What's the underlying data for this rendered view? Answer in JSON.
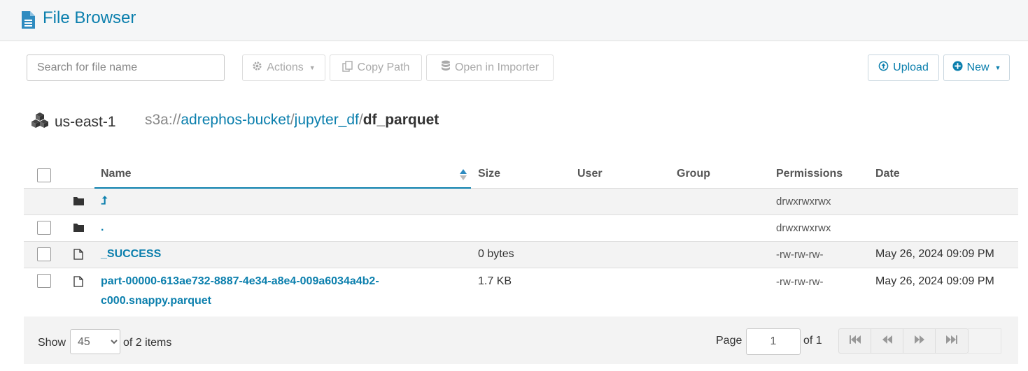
{
  "header": {
    "title": "File Browser",
    "icon": "document-icon",
    "accent": "#0b7fad"
  },
  "toolbar": {
    "search_placeholder": "Search for file name",
    "actions_label": "Actions",
    "copy_path_label": "Copy Path",
    "open_importer_label": "Open in Importer",
    "upload_label": "Upload",
    "new_label": "New"
  },
  "breadcrumb": {
    "region": "us-east-1",
    "scheme": "s3a://",
    "parts": [
      "adrephos-bucket",
      "jupyter_df"
    ],
    "current": "df_parquet",
    "separator": "/"
  },
  "table": {
    "columns": {
      "name": "Name",
      "size": "Size",
      "user": "User",
      "group": "Group",
      "permissions": "Permissions",
      "date": "Date"
    },
    "rows": [
      {
        "type": "folder",
        "name": "⮥",
        "size": "",
        "user": "",
        "group": "",
        "permissions": "drwxrwxrwx",
        "date": ""
      },
      {
        "type": "folder",
        "name": ".",
        "size": "",
        "user": "",
        "group": "",
        "permissions": "drwxrwxrwx",
        "date": ""
      },
      {
        "type": "file",
        "name": "_SUCCESS",
        "size": "0 bytes",
        "user": "",
        "group": "",
        "permissions": "-rw-rw-rw-",
        "date": "May 26, 2024 09:09 PM"
      },
      {
        "type": "file",
        "name_line1": "part-00000-613ae732-8887-4e34-a8e4-009a6034a4b2-",
        "name_line2": "c000.snappy.parquet",
        "size": "1.7 KB",
        "user": "",
        "group": "",
        "permissions": "-rw-rw-rw-",
        "date": "May 26, 2024 09:09 PM"
      }
    ]
  },
  "footer": {
    "show_label": "Show",
    "page_size": "45",
    "items_label": "of 2 items",
    "page_label": "Page",
    "page_value": "1",
    "of_pages": "of 1"
  }
}
